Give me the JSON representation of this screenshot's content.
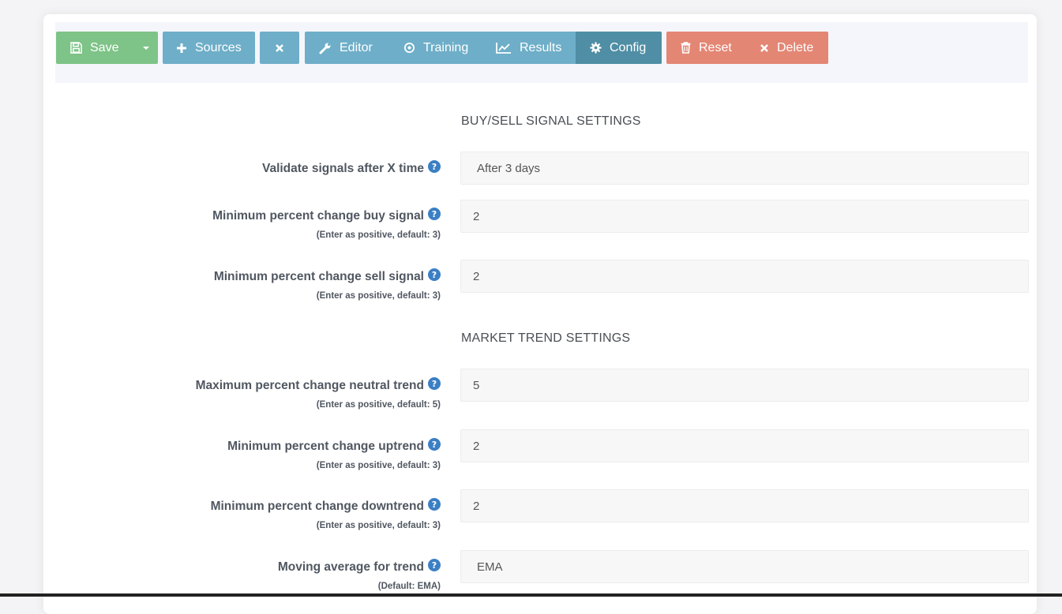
{
  "toolbar": {
    "save": "Save",
    "sources": "Sources",
    "editor": "Editor",
    "training": "Training",
    "results": "Results",
    "config": "Config",
    "reset": "Reset",
    "delete": "Delete"
  },
  "colors": {
    "green": "#7ec387",
    "blue": "#6eaec8",
    "active_blue": "#4f8ea4",
    "red": "#e48674",
    "help_icon": "#3b7fc4"
  },
  "sections": {
    "signal": "BUY/SELL SIGNAL SETTINGS",
    "trend": "MARKET TREND SETTINGS"
  },
  "fields": [
    {
      "label": "Validate signals after X time",
      "hint": "",
      "value": "After 3 days",
      "type": "select"
    },
    {
      "label": "Minimum percent change buy signal",
      "hint": "(Enter as positive, default: 3)",
      "value": "2",
      "type": "number"
    },
    {
      "label": "Minimum percent change sell signal",
      "hint": "(Enter as positive, default: 3)",
      "value": "2",
      "type": "number"
    },
    {
      "label": "Maximum percent change neutral trend",
      "hint": "(Enter as positive, default: 5)",
      "value": "5",
      "type": "number"
    },
    {
      "label": "Minimum percent change uptrend",
      "hint": "(Enter as positive, default: 3)",
      "value": "2",
      "type": "number"
    },
    {
      "label": "Minimum percent change downtrend",
      "hint": "(Enter as positive, default: 3)",
      "value": "2",
      "type": "number"
    },
    {
      "label": "Moving average for trend",
      "hint": "(Default: EMA)",
      "value": "EMA",
      "type": "select"
    }
  ]
}
